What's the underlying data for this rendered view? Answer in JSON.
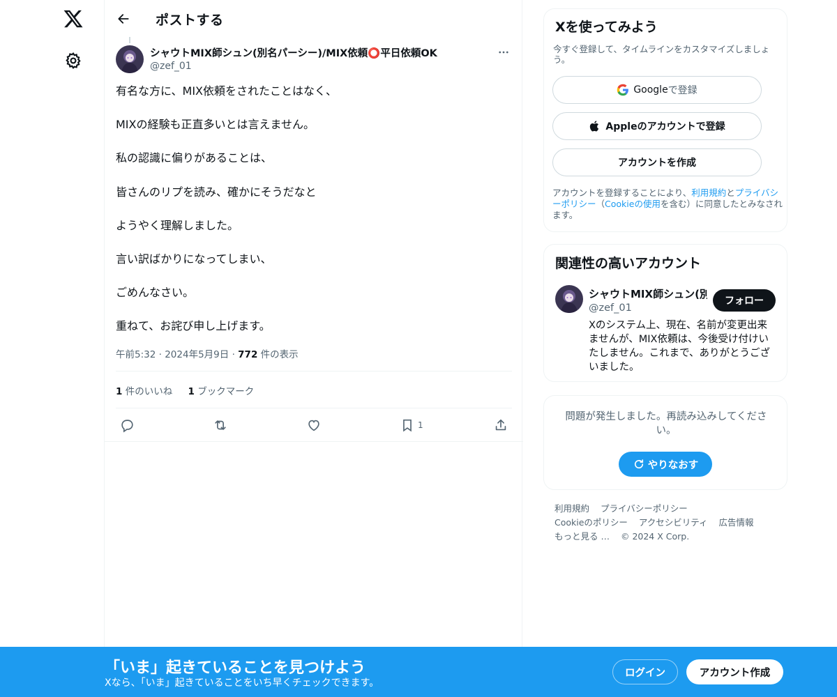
{
  "header": {
    "title": "ポストする"
  },
  "post": {
    "author_name": "シャウトMIX師シュン(別名パーシー)/MIX依頼⭕平日依頼OK",
    "author_handle": "@zef_01",
    "lines": [
      "有名な方に、MIX依頼をされたことはなく、",
      "MIXの経験も正直多いとは言えません。",
      "私の認識に偏りがあることは、",
      "皆さんのリプを読み、確かにそうだなと",
      "ようやく理解しました。",
      "言い訳ばかりになってしまい、",
      "ごめんなさい。",
      "重ねて、お詫び申し上げます。"
    ],
    "time": "午前5:32",
    "date": "2024年5月9日",
    "separator": "·",
    "views_count": "772",
    "views_label": "件の表示",
    "likes_count": "1",
    "likes_label": "件のいいね",
    "bookmarks_count": "1",
    "bookmarks_label": "ブックマーク",
    "bookmark_action_count": "1"
  },
  "signup_card": {
    "title": "Xを使ってみよう",
    "subtitle": "今すぐ登録して、タイムラインをカスタマイズしましょう。",
    "google_brand": "Google",
    "google_suffix": " で登録",
    "apple_label": "Appleのアカウントで登録",
    "create_label": "アカウントを作成",
    "legal_prefix": "アカウントを登録することにより、",
    "legal_terms": "利用規約",
    "legal_and": "と",
    "legal_privacy": "プライバシーポリシー",
    "legal_open": "（",
    "legal_cookie": "Cookieの使用",
    "legal_suffix": "を含む）に同意したとみなされます。"
  },
  "related": {
    "title": "関連性の高いアカウント",
    "name": "シャウトMIX師シュン(別名パーシー)/MIX依頼⭕平日依頼OK",
    "handle": "@zef_01",
    "follow_label": "フォロー",
    "bio": "Xのシステム上、現在、名前が変更出来ませんが、MIX依頼は、今後受け付けいたしません。これまで、ありがとうございました。"
  },
  "error_card": {
    "message": "問題が発生しました。再読み込みしてください。",
    "retry_label": "やりなおす"
  },
  "footer": {
    "terms": "利用規約",
    "privacy": "プライバシーポリシー",
    "cookie": "Cookieのポリシー",
    "accessibility": "アクセシビリティ",
    "ads": "広告情報",
    "more": "もっと見る …",
    "copyright": "© 2024 X Corp."
  },
  "banner": {
    "title": "「いま」起きていることを見つけよう",
    "subtitle": "Xなら、「いま」起きていることをいち早くチェックできます。",
    "login_label": "ログイン",
    "signup_label": "アカウント作成"
  },
  "colors": {
    "accent": "#1d9bf0",
    "text": "#0f1419",
    "secondary": "#536471",
    "border": "#eff3f4"
  },
  "icons": [
    "x-logo-icon",
    "settings-icon",
    "back-arrow-icon",
    "more-icon",
    "reply-icon",
    "repost-icon",
    "like-icon",
    "bookmark-icon",
    "share-icon",
    "google-icon",
    "apple-icon",
    "refresh-icon"
  ]
}
